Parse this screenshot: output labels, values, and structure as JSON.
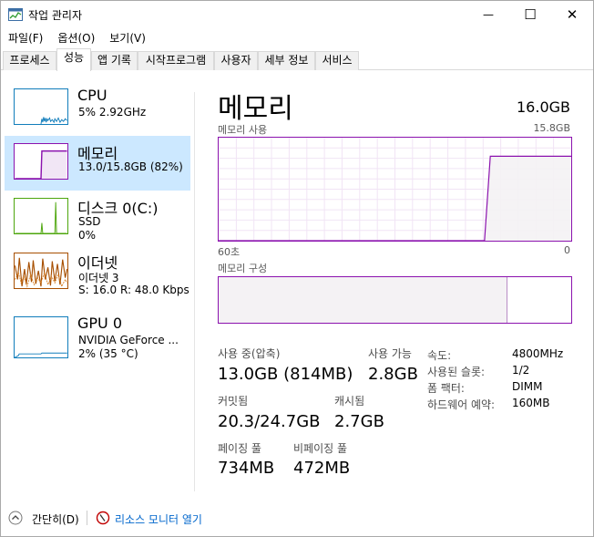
{
  "window": {
    "title": "작업 관리자",
    "minimize_glyph": "—",
    "maximize_glyph": "☐",
    "close_glyph": "✕"
  },
  "menu": [
    "파일(F)",
    "옵션(O)",
    "보기(V)"
  ],
  "tabs": [
    "프로세스",
    "성능",
    "앱 기록",
    "시작프로그램",
    "사용자",
    "세부 정보",
    "서비스"
  ],
  "active_tab": "성능",
  "sidebar": {
    "items": [
      {
        "name": "CPU",
        "line1": "5% 2.92GHz",
        "line2": "",
        "color": "#117dbb"
      },
      {
        "name": "메모리",
        "line1": "13.0/15.8GB (82%)",
        "line2": "",
        "color": "#8b12ae",
        "selected": true
      },
      {
        "name": "디스크 0(C:)",
        "line1": "SSD",
        "line2": "0%",
        "color": "#4da60c"
      },
      {
        "name": "이더넷",
        "line1": "이더넷 3",
        "line2": "S: 16.0  R: 48.0 Kbps",
        "color": "#a74f01"
      },
      {
        "name": "GPU 0",
        "line1": "NVIDIA GeForce ...",
        "line2": "2% (35 °C)",
        "color": "#117dbb"
      }
    ]
  },
  "main": {
    "title": "메모리",
    "total": "16.0GB",
    "usage_label": "메모리 사용",
    "usage_max": "15.8GB",
    "axis_left": "60초",
    "axis_right": "0",
    "composition_label": "메모리 구성",
    "accent_color": "#8b12ae",
    "fill_color": "#f4f2f4",
    "usage_history_percent": [
      0,
      0,
      0,
      0,
      0,
      0,
      0,
      0,
      0,
      0,
      0,
      0,
      0,
      0,
      0,
      0,
      0,
      0,
      0,
      0,
      0,
      0,
      0,
      0,
      0,
      0,
      0,
      0,
      0,
      0,
      0,
      0,
      0,
      0,
      0,
      0,
      0,
      0,
      0,
      0,
      0,
      0,
      0,
      0,
      0,
      0,
      0,
      82,
      82,
      82,
      82,
      82,
      82,
      82,
      82,
      82,
      82,
      82,
      82,
      82,
      82,
      82
    ],
    "composition_in_use_fraction": 0.82
  },
  "stats": {
    "in_use_label": "사용 중(압축)",
    "in_use_value": "13.0GB (814MB)",
    "available_label": "사용 가능",
    "available_value": "2.8GB",
    "committed_label": "커밋됨",
    "committed_value": "20.3/24.7GB",
    "cached_label": "캐시됨",
    "cached_value": "2.7GB",
    "paged_label": "페이징 풀",
    "paged_value": "734MB",
    "nonpaged_label": "비페이징 풀",
    "nonpaged_value": "472MB"
  },
  "details": [
    {
      "label": "속도:",
      "value": "4800MHz"
    },
    {
      "label": "사용된 슬롯:",
      "value": "1/2"
    },
    {
      "label": "폼 팩터:",
      "value": "DIMM"
    },
    {
      "label": "하드웨어 예약:",
      "value": "160MB"
    }
  ],
  "footer": {
    "fewer_details": "간단히(D)",
    "resource_monitor": "리소스 모니터 열기"
  }
}
